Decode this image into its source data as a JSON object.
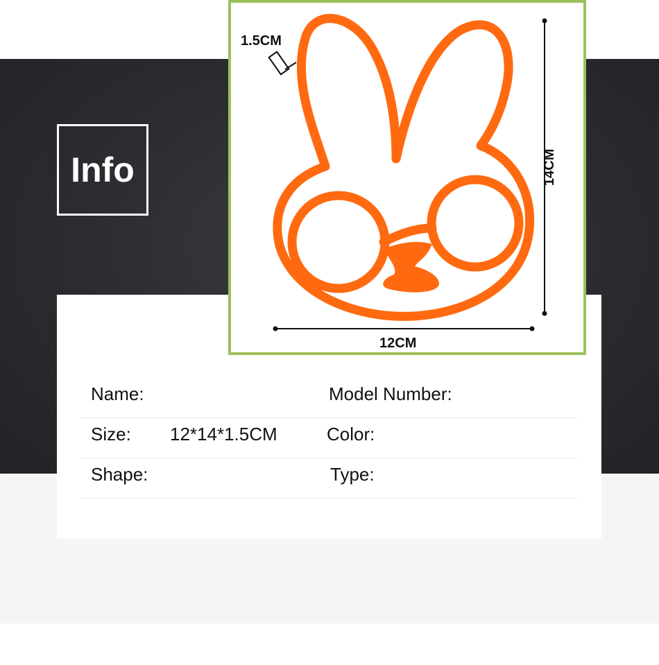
{
  "header": {
    "badge": "Info"
  },
  "product_image": {
    "dimensions": {
      "thickness": "1.5CM",
      "height": "14CM",
      "width": "12CM"
    },
    "colors": {
      "frame": "#9dc15a",
      "mold": "#ff6a10"
    }
  },
  "specs": {
    "name_label": "Name:",
    "model_label": "Model Number:",
    "size_label": "Size:",
    "size_value": "12*14*1.5CM",
    "color_label": "Color:",
    "shape_label": "Shape:",
    "type_label": "Type:"
  }
}
